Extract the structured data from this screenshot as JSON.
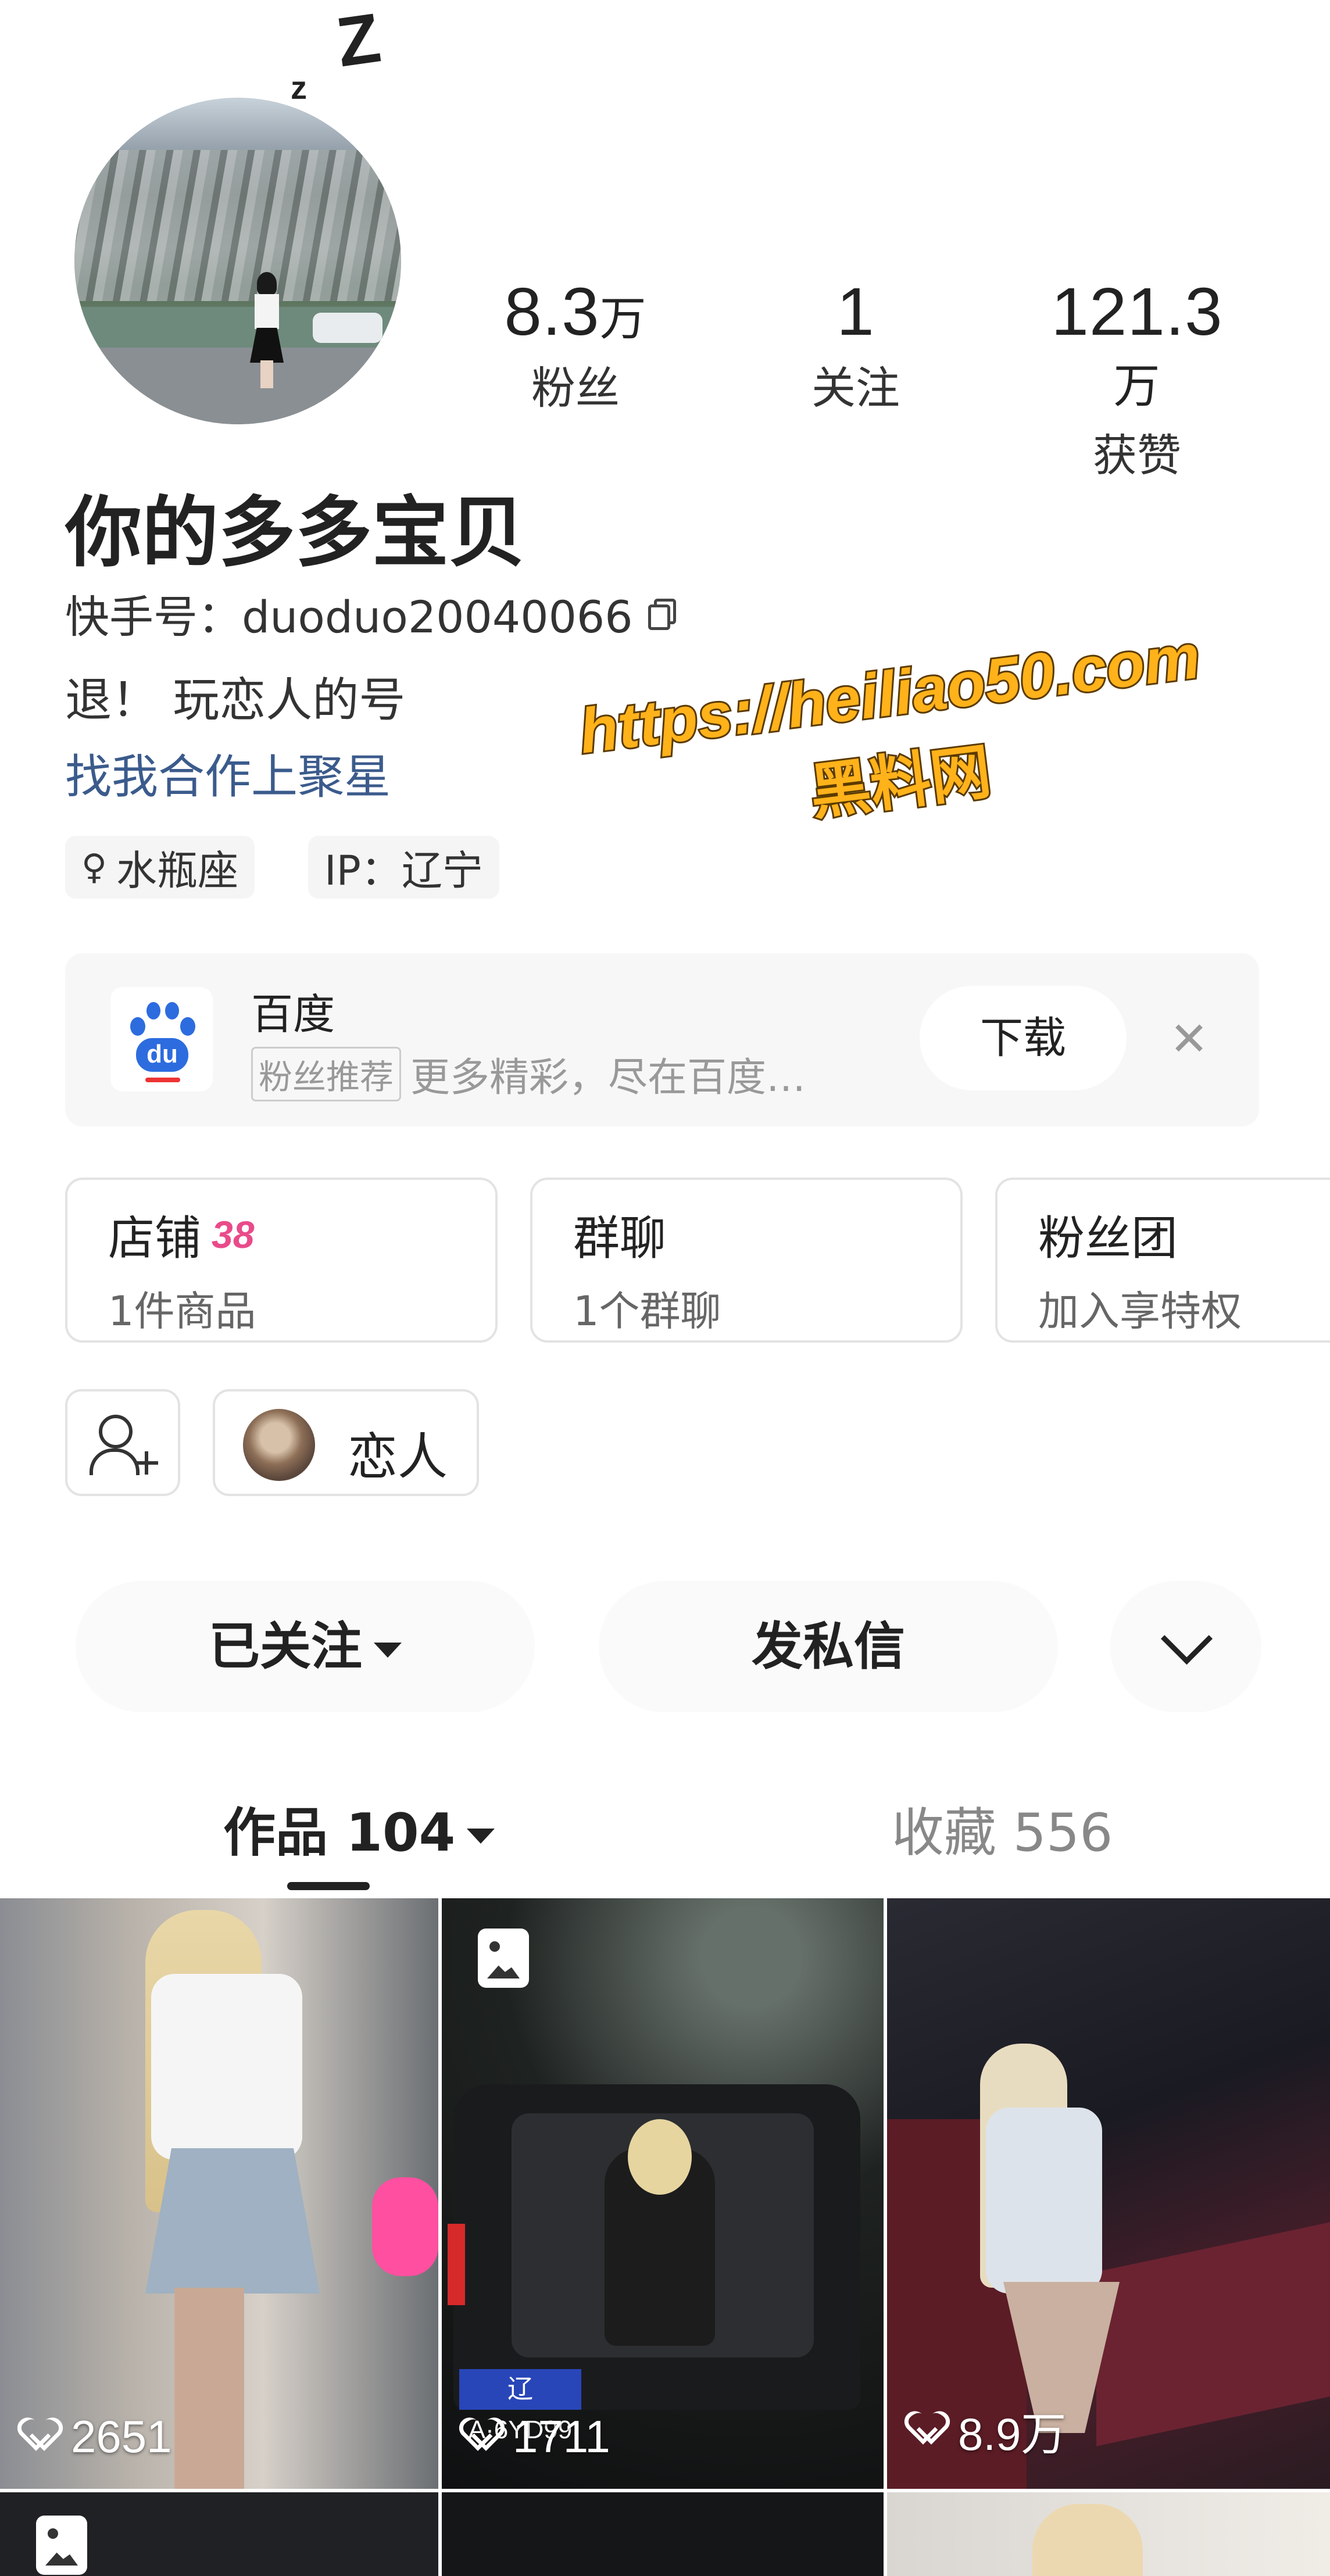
{
  "decor": {
    "z_big": "Z",
    "z_small": "z"
  },
  "profile": {
    "stats": [
      {
        "num": "8.3",
        "unit": "万",
        "label": "粉丝"
      },
      {
        "num": "1",
        "unit": "",
        "label": "关注"
      },
      {
        "num": "121.3",
        "unit": "万",
        "label": "获赞"
      }
    ],
    "name": "你的多多宝贝",
    "kuaishou_id": "快手号：duoduo20040066",
    "bio_line1": "退！ 玩恋人的号",
    "bio_line2": "找我合作上聚星",
    "tags": [
      "水瓶座",
      "IP：辽宁"
    ]
  },
  "watermark": {
    "url": "https://heiliao50.com",
    "cn": "黑料网"
  },
  "ad": {
    "logo_text": "du",
    "title": "百度",
    "badge": "粉丝推荐",
    "desc": "更多精彩，尽在百度…",
    "button": "下载",
    "close": "✕"
  },
  "cards": [
    {
      "title": "店铺",
      "badge": "38",
      "sub": "1件商品"
    },
    {
      "title": "群聊",
      "badge": "",
      "sub": "1个群聊"
    },
    {
      "title": "粉丝团",
      "badge": "",
      "sub": "加入享特权"
    }
  ],
  "lover": {
    "label": "恋人"
  },
  "actions": {
    "followed": "已关注",
    "message": "发私信"
  },
  "tabs": {
    "works": "作品 104",
    "favorites": "收藏 556"
  },
  "videos": [
    {
      "likes": "2651",
      "type": "video"
    },
    {
      "likes": "1711",
      "type": "image",
      "plate": "辽A·6YD99"
    },
    {
      "likes": "8.9万",
      "type": "video"
    }
  ],
  "colors": {
    "link": "#3b5b8c",
    "badge38": "#e94b8a",
    "watermark": "#ffb21a"
  }
}
